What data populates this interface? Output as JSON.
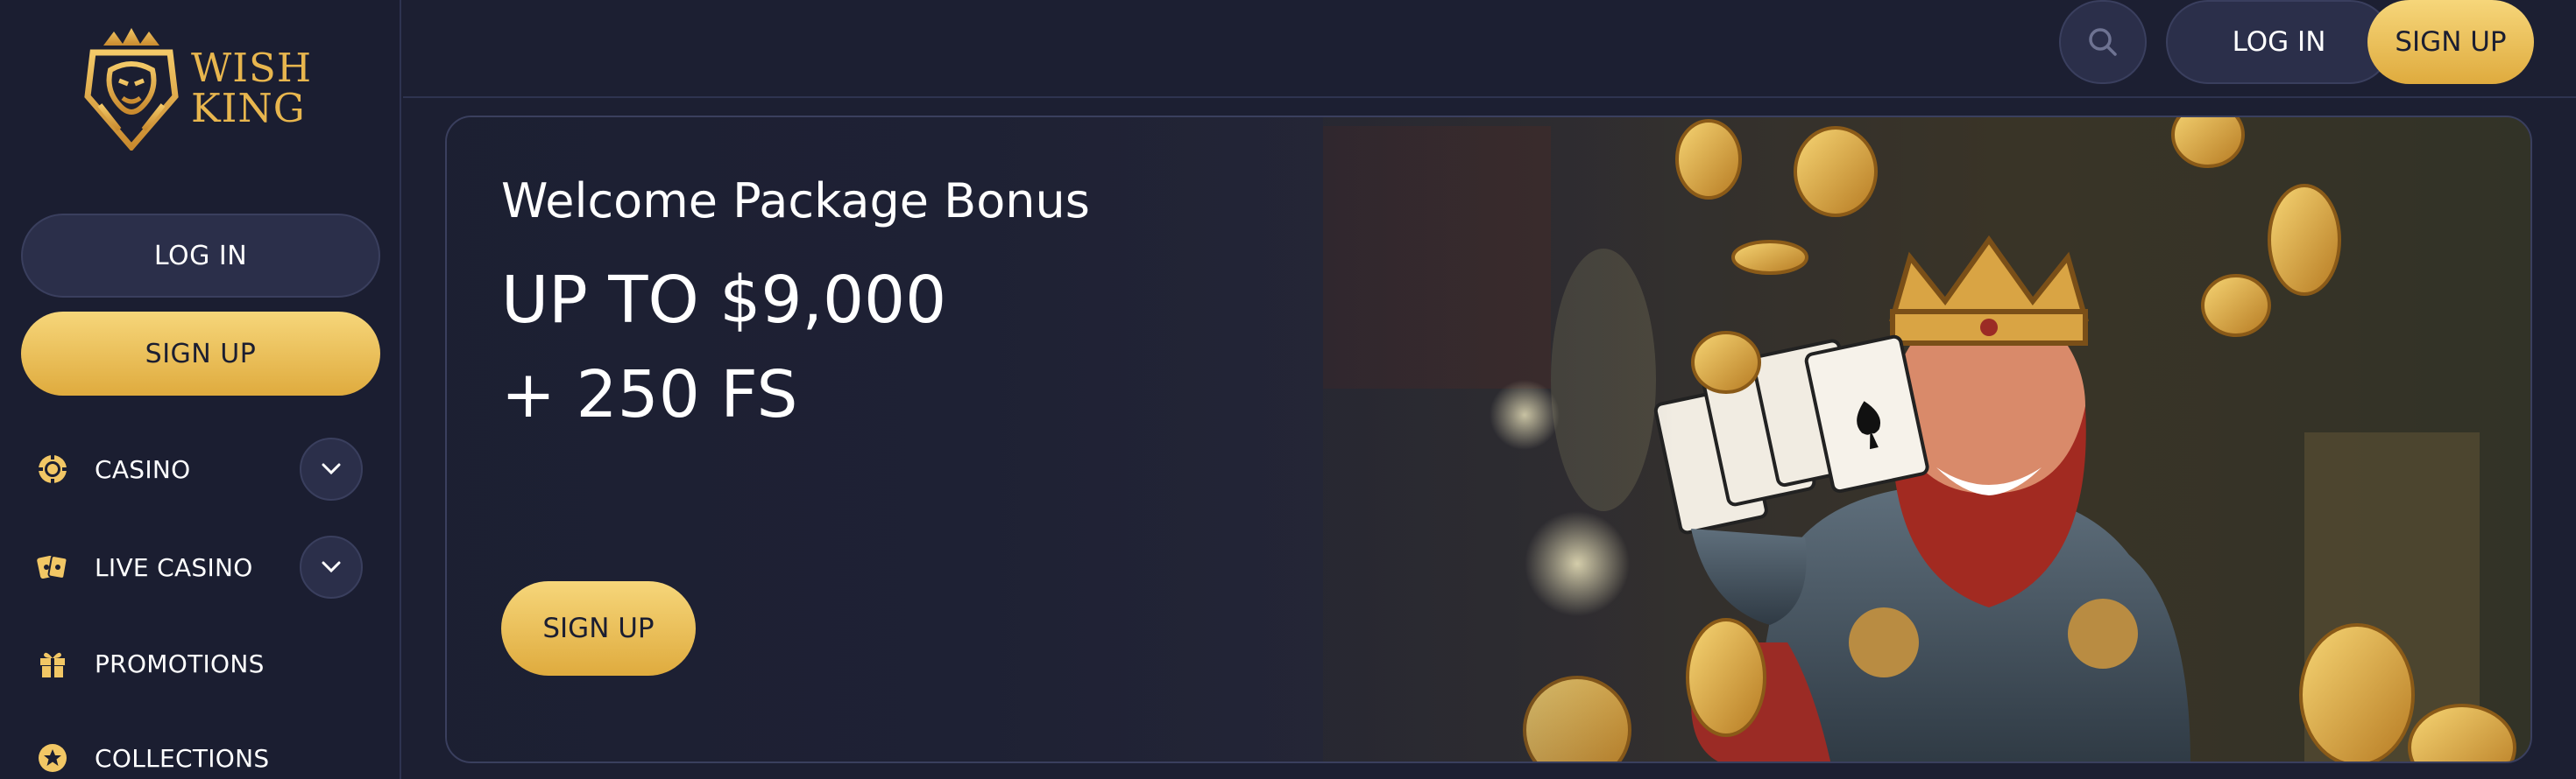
{
  "brand": {
    "logo_line1": "WISH",
    "logo_line2": "KING",
    "accent_color": "#e8b64e"
  },
  "sidebar": {
    "login_label": "LOG IN",
    "signup_label": "SIGN UP",
    "items": [
      {
        "label": "CASINO",
        "icon": "casino-chip-icon",
        "has_submenu": true
      },
      {
        "label": "LIVE CASINO",
        "icon": "live-casino-cards-icon",
        "has_submenu": true
      },
      {
        "label": "PROMOTIONS",
        "icon": "gift-icon",
        "has_submenu": false
      },
      {
        "label": "COLLECTIONS",
        "icon": "collections-star-icon",
        "has_submenu": false
      }
    ]
  },
  "header": {
    "search_icon": "search-icon",
    "login_label": "LOG IN",
    "signup_label": "SIGN UP"
  },
  "banner": {
    "title": "Welcome Package Bonus",
    "amount": "UP TO $9,000",
    "free_spins": "+ 250 FS",
    "cta_label": "SIGN UP"
  }
}
